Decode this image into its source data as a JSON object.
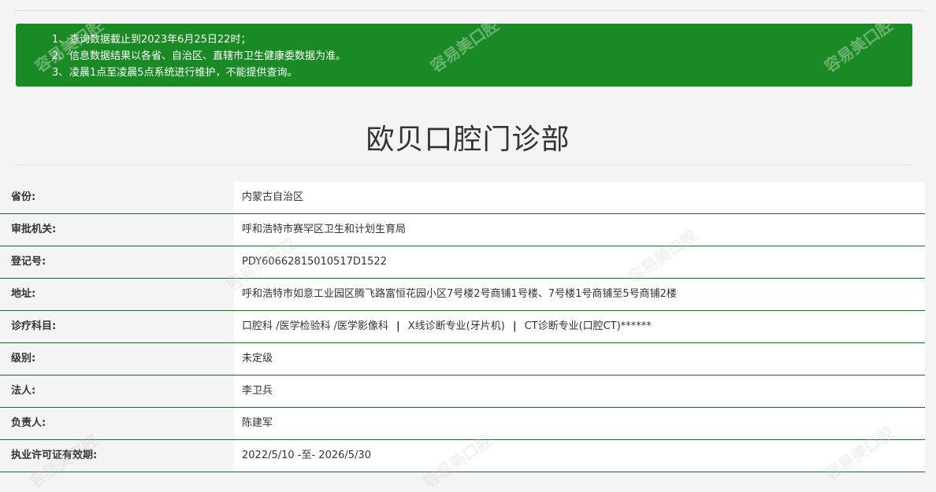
{
  "notice": {
    "items": [
      {
        "num": "1、",
        "text": "查询数据截止到2023年6月25日22时；"
      },
      {
        "num": "2、",
        "text": "信息数据结果以各省、自治区、直辖市卫生健康委数据为准。"
      },
      {
        "num": "3、",
        "text": "凌晨1点至凌晨5点系统进行维护，不能提供查询。"
      }
    ]
  },
  "title": "欧贝口腔门诊部",
  "rows": [
    {
      "label": "省份:",
      "value": "内蒙古自治区"
    },
    {
      "label": "审批机关:",
      "value": "呼和浩特市赛罕区卫生和计划生育局"
    },
    {
      "label": "登记号:",
      "value": "PDY60662815010517D1522"
    },
    {
      "label": "地址:",
      "value": "呼和浩特市如意工业园区腾飞路富恒花园小区7号楼2号商铺1号楼、7号楼1号商铺至5号商铺2楼"
    },
    {
      "label": "诊疗科目:",
      "value_parts": [
        "口腔科 /医学检验科 /医学影像科",
        "X线诊断专业(牙片机)",
        "CT诊断专业(口腔CT)******"
      ],
      "separator": "|"
    },
    {
      "label": "级别:",
      "value": "未定级"
    },
    {
      "label": "法人:",
      "value": "李卫兵"
    },
    {
      "label": "负责人:",
      "value": "陈建军"
    },
    {
      "label": "执业许可证有效期:",
      "value": "2022/5/10 -至- 2026/5/30"
    }
  ],
  "watermark": {
    "text": "容易美口腔",
    "url": "www.easyjf.com"
  },
  "colors": {
    "notice_bg": "#1a8a24",
    "row_border": "#1f6b2a"
  }
}
